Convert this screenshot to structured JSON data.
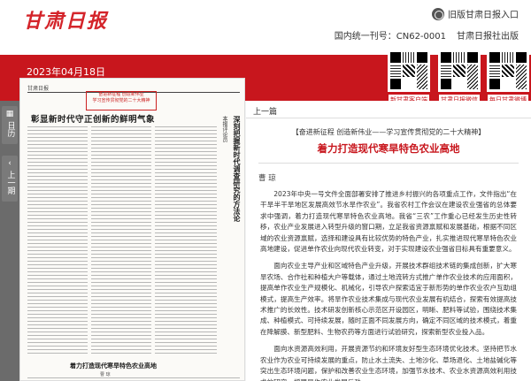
{
  "header": {
    "logo": "甘肃日报",
    "old_version_link": "旧版甘肃日报入口",
    "publication_code": "国内统一刊号：CN62-0001",
    "publisher": "甘肃日报社出版"
  },
  "date": "2023年04月18日",
  "qr_codes": [
    {
      "label": "新甘肃客户端"
    },
    {
      "label": "甘肃日报微信"
    },
    {
      "label": "每日甘肃微博"
    }
  ],
  "sidenav": {
    "calendar_label": "日历",
    "prev_label": "上一期"
  },
  "page_preview": {
    "header_text": "甘肃日报",
    "banner_line1": "奋进新征程 创造新伟业",
    "banner_line2": "学习宣传贯彻党的二十大精神",
    "title": "彰显新时代守正创新的鲜明气象",
    "vertical_title": "深刻把握新时代调查研究的方法论",
    "vertical_byline": "本报评论员",
    "sub_title": "着力打造现代寒旱特色农业高地",
    "sub_byline": "曹 琼"
  },
  "article": {
    "nav_prev": "上一篇",
    "kicker": "【奋进新征程 创造新伟业——学习宣传贯彻党的二十大精神】",
    "headline": "着力打造现代寒旱特色农业高地",
    "author": "曹  琼",
    "paragraphs": [
      "2023年中央一号文件全面部署安排了推进乡村振兴的各项重点工作，文件指出“在干旱半干旱地区发展高效节水旱作农业”。我省农村工作会议在建设农业强省的总体要求中强调，着力打造现代寒旱特色农业高地。我省“三农”工作重心已经发生历史性转移，农业产业发展进入转型升级的窗口期，立足我省资源禀赋和发展基础，根据不同区域的农业资源禀赋，选择和建设具有比较优势的特色产业，扎实推进现代寒旱特色农业高地建设，促进单作农业向现代农业转变，对于实现建设农业强省目标具有重要意义。",
      "面向农业主导产业和区域特色产业升级，开展技术群组技术链的集成创新，扩大寒旱农场、合作社和种植大户等载体，通过土地流转方式推广单作农业技术的应用面积，提高单作农业生产规模化、机械化，引导农户探索适宜于新形势的单作农业农户互助组模式，提高生产效率。将旱作农业技术集成与现代农业发展有机结合，探索有效提高技术推广的长效性。技术研发创新核心示范区开设园区，明晰、肥料等试验，围绕技术集成、种植模式、可持续发展，随时正面不同发展方向，确定不同区域的技术模式，着重在降解膜、新型肥料、生物农药等方面进行试验研究，探索新型农业投入品。",
      "面向水资源高效利用，开展资源节约和环境友好型生态环境优化技术。坚持把节水农业作为农业可持续发展的重点，防止水土流失、土地沙化、草场退化、土地盐碱化等突出生态环境问题，保护和改善农业生态环境，加强节水技术、农业水资源高效利用技术的研究，增强旱作农业发展后劲。"
    ]
  },
  "colors": {
    "brand_red": "#c8161d",
    "nav_gray": "#6b6b6b"
  }
}
